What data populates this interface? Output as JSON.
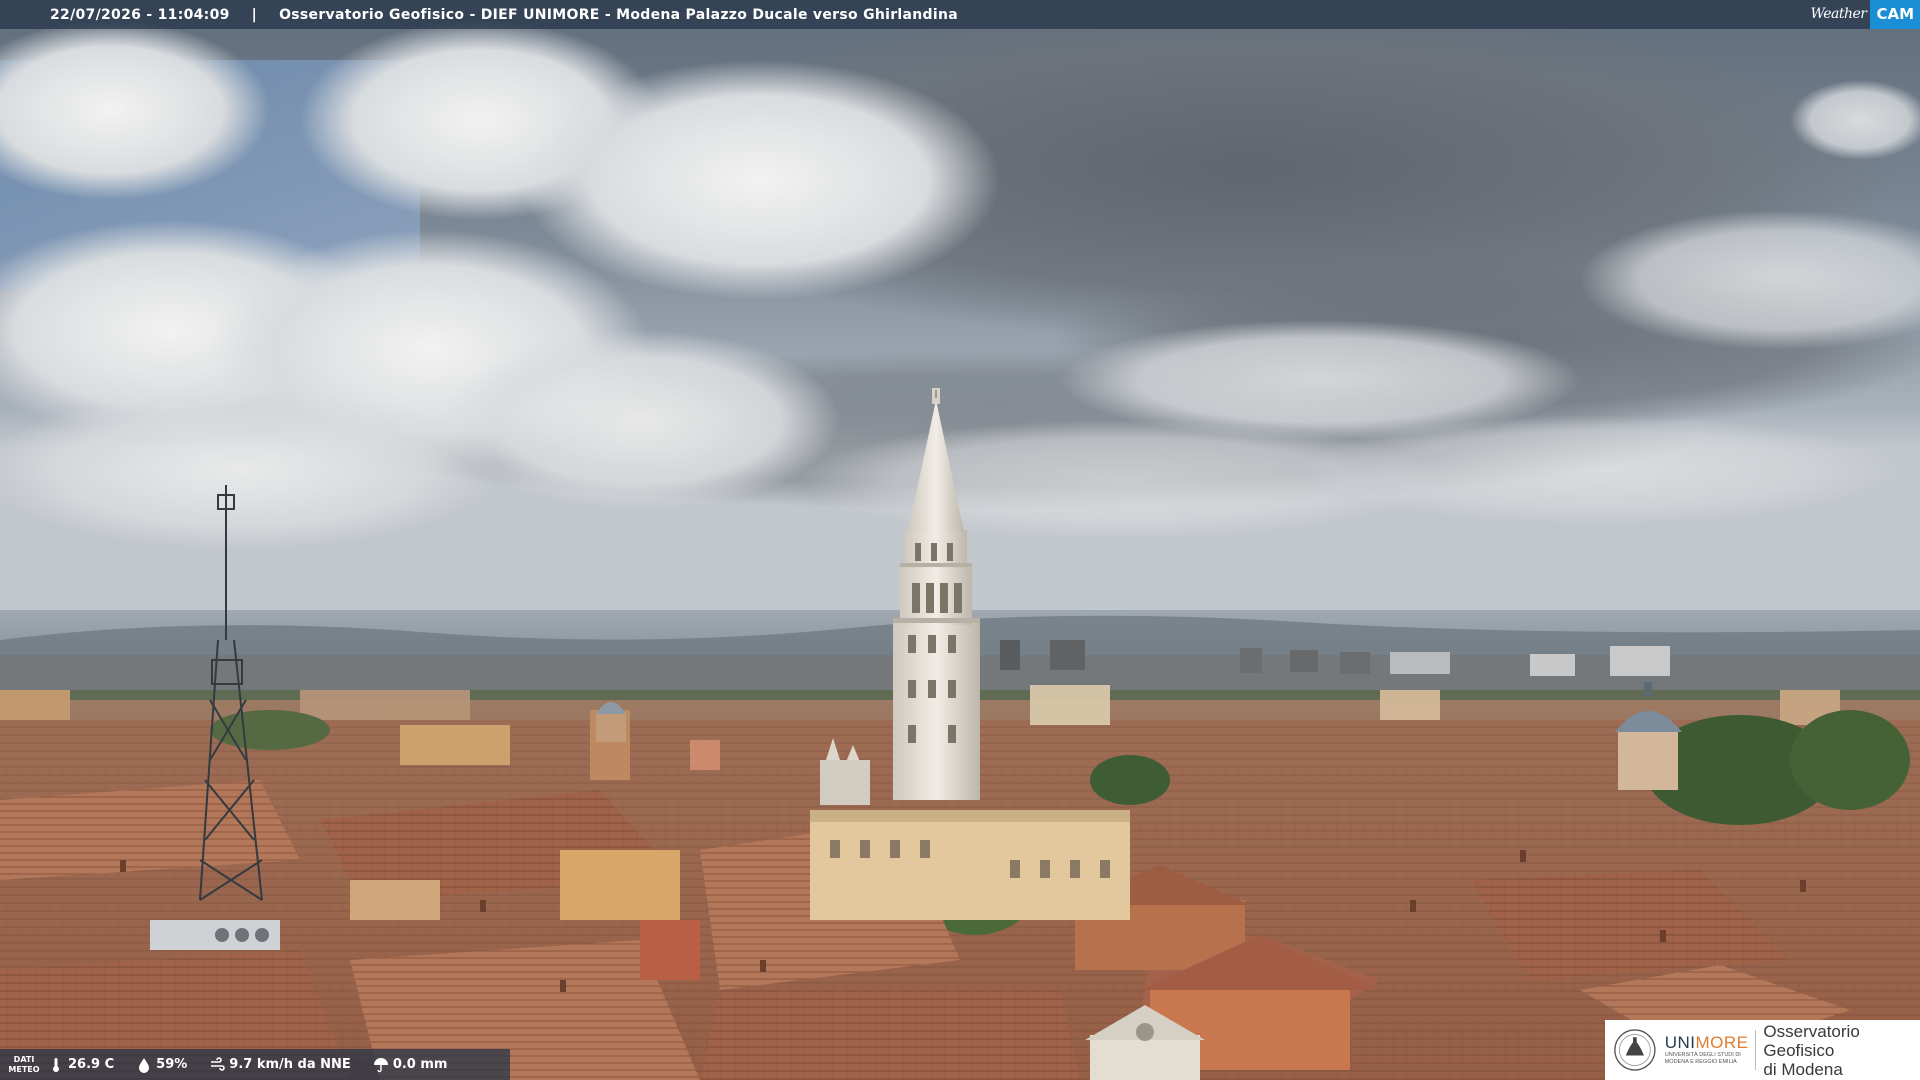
{
  "overlay": {
    "timestamp": "22/07/2026 - 11:04:09",
    "separator": "|",
    "title": "Osservatorio Geofisico - DIEF UNIMORE - Modena Palazzo Ducale verso Ghirlandina"
  },
  "brand": {
    "part1": "Weather",
    "part2": "CAM",
    "icon": "weathercam-logo"
  },
  "meteo": {
    "label": "DATI\nMETEO",
    "temperature": "26.9 C",
    "humidity": "59%",
    "wind": "9.7 km/h da NNE",
    "rain": "0.0 mm",
    "icons": {
      "temperature": "thermometer-icon",
      "humidity": "drop-icon",
      "wind": "wind-icon",
      "rain": "umbrella-icon"
    }
  },
  "institution": {
    "name_part1": "UNI",
    "name_part2": "MORE",
    "subtitle": "UNIVERSITÀ DEGLI STUDI DI\nMODENA E REGGIO EMILIA",
    "observatory": "Osservatorio Geofisico\ndi Modena",
    "colors": {
      "uni": "#2a3b4d",
      "more": "#e07d2e"
    }
  },
  "scene": {
    "subject": "panorama-city-with-tower",
    "colors": {
      "sky": "#8f9aa6",
      "clouds": "#e4e6e8",
      "roofs": "#a8674a",
      "tower": "#e6e1d8"
    }
  }
}
